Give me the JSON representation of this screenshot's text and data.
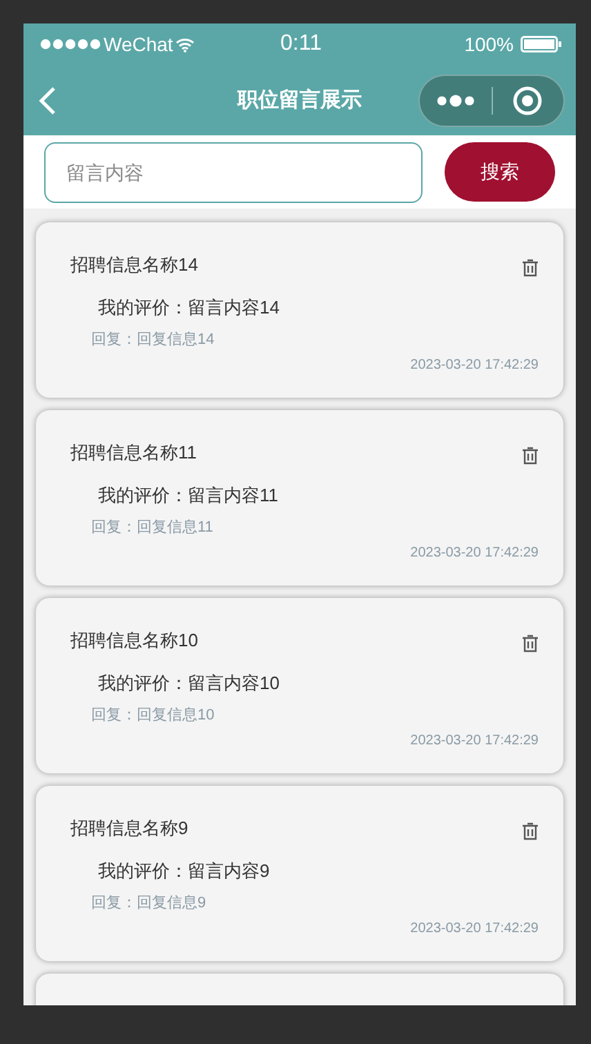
{
  "status_bar": {
    "carrier": "WeChat",
    "time": "0:11",
    "battery": "100%"
  },
  "nav_bar": {
    "title": "职位留言展示"
  },
  "search": {
    "placeholder": "留言内容",
    "button": "搜索"
  },
  "messages": [
    {
      "title": "招聘信息名称14",
      "comment": "我的评价：留言内容14",
      "reply": "回复：回复信息14",
      "time": "2023-03-20 17:42:29"
    },
    {
      "title": "招聘信息名称11",
      "comment": "我的评价：留言内容11",
      "reply": "回复：回复信息11",
      "time": "2023-03-20 17:42:29"
    },
    {
      "title": "招聘信息名称10",
      "comment": "我的评价：留言内容10",
      "reply": "回复：回复信息10",
      "time": "2023-03-20 17:42:29"
    },
    {
      "title": "招聘信息名称9",
      "comment": "我的评价：留言内容9",
      "reply": "回复：回复信息9",
      "time": "2023-03-20 17:42:29"
    }
  ]
}
